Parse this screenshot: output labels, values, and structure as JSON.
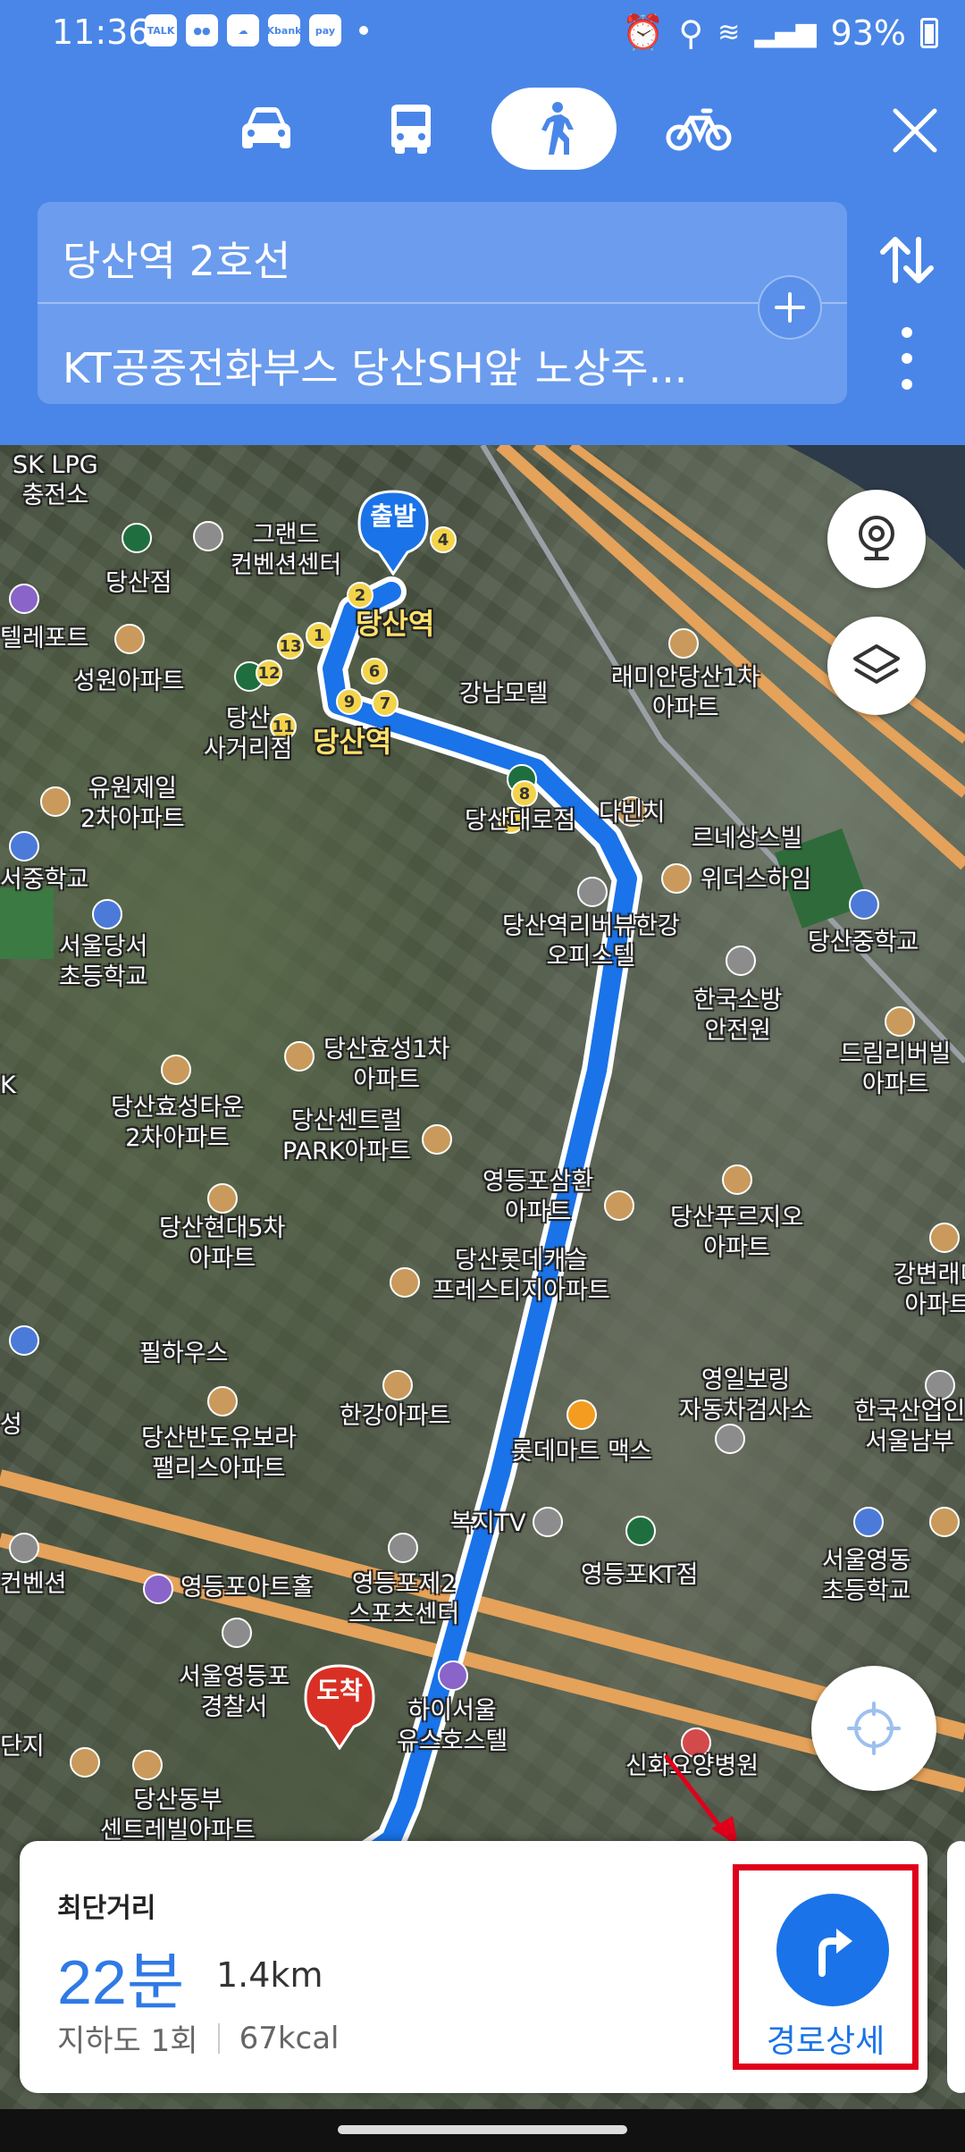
{
  "status": {
    "time": "11:36",
    "left_icons": [
      "TALK",
      "chat-bubble",
      "cloud-chat",
      "Kbank",
      "pay"
    ],
    "battery": "93%"
  },
  "modes": [
    {
      "name": "car",
      "active": false
    },
    {
      "name": "bus",
      "active": false
    },
    {
      "name": "walk",
      "active": true
    },
    {
      "name": "bike",
      "active": false
    }
  ],
  "route_inputs": {
    "start": "당산역 2호선",
    "end": "KT공중전화부스 당산SH앞 노상주..."
  },
  "map": {
    "start_pin": "출발",
    "end_pin": "도착",
    "station_labels": [
      "당산역",
      "당산역"
    ],
    "labels": {
      "l01": "SK LPG\n충전소",
      "l02": "그랜드\n컨벤션센터",
      "l03": "당산점",
      "l04": "텔레포트",
      "l05": "성원아파트",
      "l06": "당산\n사거리점",
      "l07": "강남모텔",
      "l08": "래미안당산1차\n아파트",
      "l09": "유원제일\n2차아파트",
      "l10": "당산대로점",
      "l11": "다빈치",
      "l12": "르네상스빌",
      "l13": "위더스하임",
      "l14": "서중학교",
      "l15": "당산중학교",
      "l16": "서울당서\n초등학교",
      "l17": "당산역리버뷰한강\n오피스텔",
      "l18": "한국소방\n안전원",
      "l19": "드림리버빌\n아파트",
      "l20": "당산효성1차\n아파트",
      "l21": "당산효성타운\n2차아파트",
      "l22": "당산센트럴\nPARK아파트",
      "l23": "영등포삼환\n아파트",
      "l24": "당산푸르지오\n아파트",
      "l25": "당산현대5차\n아파트",
      "l26": "당산롯데캐슬\n프레스티지아파트",
      "l27": "강변래미\n아파트",
      "l28": "필하우스",
      "l29": "영일보링\n자동차검사소",
      "l30": "한국산업인\n서울남부",
      "l31": "한강아파트",
      "l32": "당산반도유보라\n팰리스아파트",
      "l33": "롯데마트 맥스",
      "l34": "복지TV",
      "l35": "영등포KT점",
      "l36": "서울영동\n초등학교",
      "l37": "컨벤션",
      "l38": "영등포아트홀",
      "l39": "영등포제2\n스포츠센터",
      "l40": "서울영등포\n경찰서",
      "l41": "하이서울\n유스호스텔",
      "l42": "신화요양병원",
      "l43": "당산동부\n센트레빌아파트",
      "l44": "단지",
      "l45": "K",
      "l46": "성"
    },
    "station_numbers": [
      "1",
      "2",
      "4",
      "6",
      "7",
      "8",
      "9",
      "9",
      "11",
      "12",
      "13"
    ]
  },
  "route_card": {
    "title": "최단거리",
    "duration": "22분",
    "distance": "1.4km",
    "underpass": "지하도 1회",
    "calories": "67kcal",
    "detail_label": "경로상세"
  },
  "colors": {
    "header_blue": "#4a86e8",
    "route_blue": "#1a73e8",
    "highlight_red": "#e0001b",
    "road_orange": "#e5a25a"
  }
}
